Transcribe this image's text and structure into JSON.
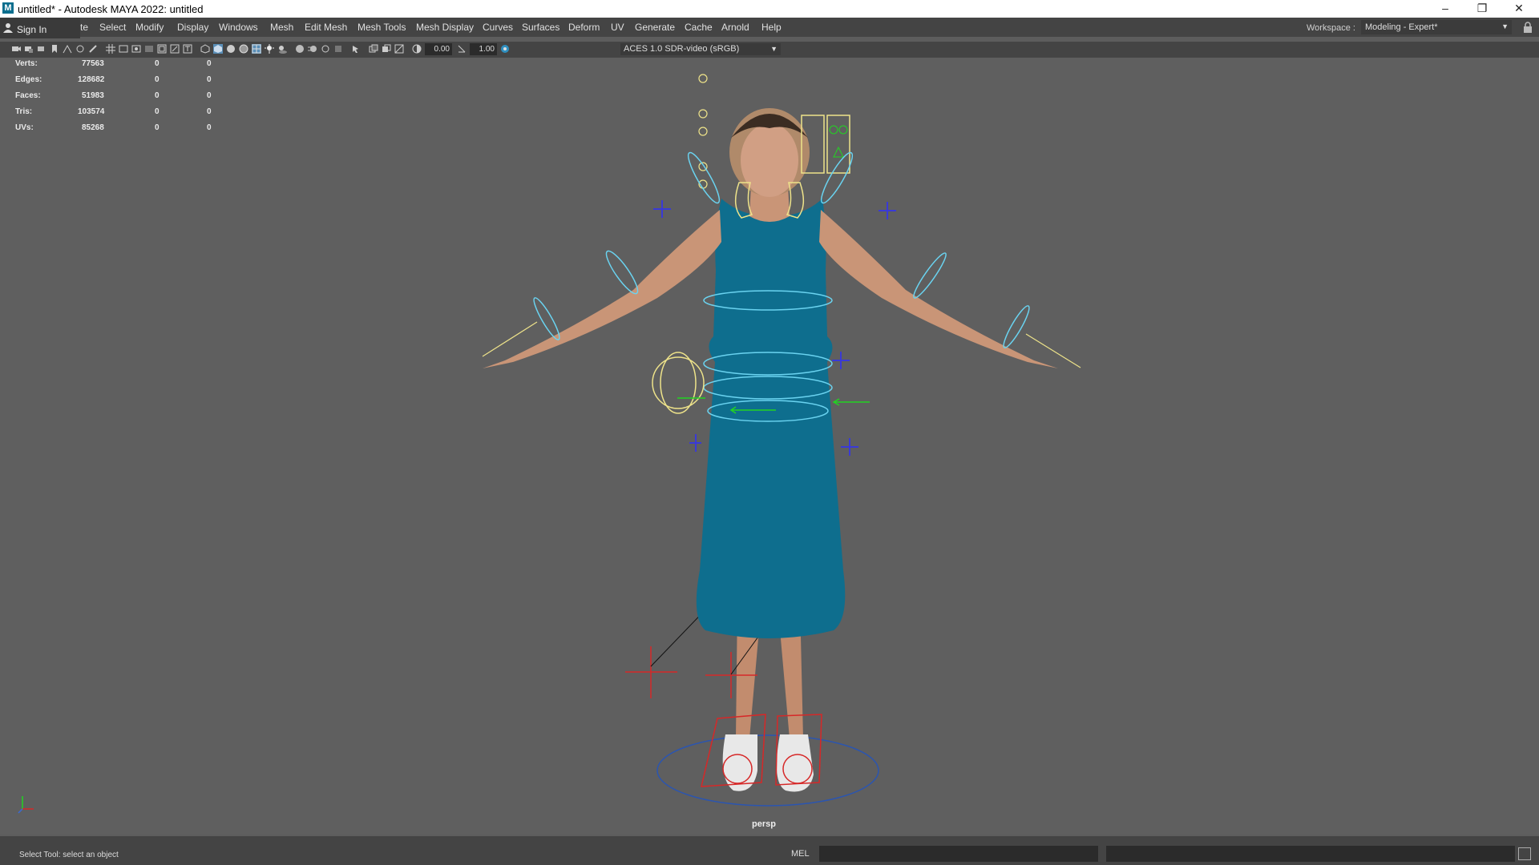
{
  "window": {
    "title": "untitled* - Autodesk MAYA 2022: untitled",
    "app_icon": "M",
    "controls": [
      "minimize-icon",
      "restore-icon",
      "close-icon"
    ],
    "control_glyphs": [
      "–",
      "❐",
      "✕"
    ]
  },
  "menubar": {
    "sign_in": "Sign In",
    "items": [
      "te",
      "Select",
      "Modify",
      "Display",
      "Windows",
      "Mesh",
      "Edit Mesh",
      "Mesh Tools",
      "Mesh Display",
      "Curves",
      "Surfaces",
      "Deform",
      "UV",
      "Generate",
      "Cache",
      "Arnold",
      "Help"
    ],
    "workspace_label": "Workspace :",
    "workspace_value": "Modeling - Expert*"
  },
  "toolbar": {
    "exposure": "0.00",
    "gamma": "1.00",
    "color_management": "ACES 1.0 SDR-video (sRGB)"
  },
  "hud": {
    "rows": [
      {
        "label": "Verts:",
        "total": "77563",
        "selected": "0",
        "selected2": "0"
      },
      {
        "label": "Edges:",
        "total": "128682",
        "selected": "0",
        "selected2": "0"
      },
      {
        "label": "Faces:",
        "total": "51983",
        "selected": "0",
        "selected2": "0"
      },
      {
        "label": "Tris:",
        "total": "103574",
        "selected": "0",
        "selected2": "0"
      },
      {
        "label": "UVs:",
        "total": "85268",
        "selected": "0",
        "selected2": "0"
      }
    ]
  },
  "viewport": {
    "camera": "persp"
  },
  "statusbar": {
    "help_text": "Select Tool: select an object",
    "command_language": "MEL"
  },
  "colors": {
    "dress": "#0e6e8e",
    "skin": "#c99577",
    "ctrl_cyan": "#6ad3f0",
    "ctrl_yellow": "#eee38a",
    "ctrl_red": "#d62828",
    "ctrl_blue": "#3a3ad6",
    "ctrl_green": "#22d322"
  }
}
